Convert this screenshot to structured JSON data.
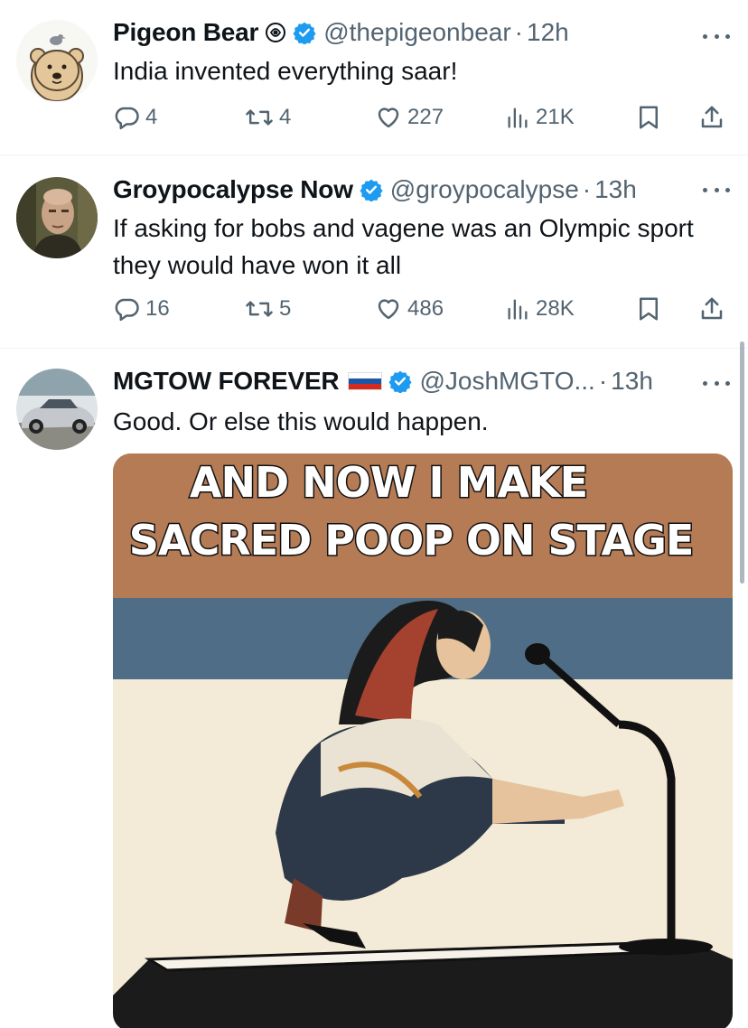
{
  "tweets": [
    {
      "name": "Pigeon Bear",
      "handle": "@thepigeonbear",
      "time": "12h",
      "text": "India invented everything saar!",
      "replies": "4",
      "reposts": "4",
      "likes": "227",
      "views": "21K"
    },
    {
      "name": "Groypocalypse Now",
      "handle": "@groypocalypse",
      "time": "13h",
      "text": "If asking for bobs and vagene was an Olympic sport they would have won it all",
      "replies": "16",
      "reposts": "5",
      "likes": "486",
      "views": "28K"
    },
    {
      "name": "MGTOW FOREVER",
      "handle": "@JoshMGTO...",
      "time": "13h",
      "text": "Good. Or else this would happen.",
      "meme_caption_line1": "AND NOW I MAKE",
      "meme_caption_line2": "SACRED POOP ON STAGE"
    }
  ],
  "separator": "·",
  "icons": {
    "verified": "verified-badge-icon",
    "reply": "reply-icon",
    "repost": "repost-icon",
    "like": "heart-icon",
    "views": "views-icon",
    "bookmark": "bookmark-icon",
    "share": "share-icon",
    "more": "more-icon",
    "affiliate": "affiliate-swirl-icon",
    "flag": "russia-flag-icon"
  },
  "colors": {
    "verified": "#1d9bf0",
    "text": "#0f1419",
    "secondary": "#536471",
    "divider": "#eff3f4"
  }
}
